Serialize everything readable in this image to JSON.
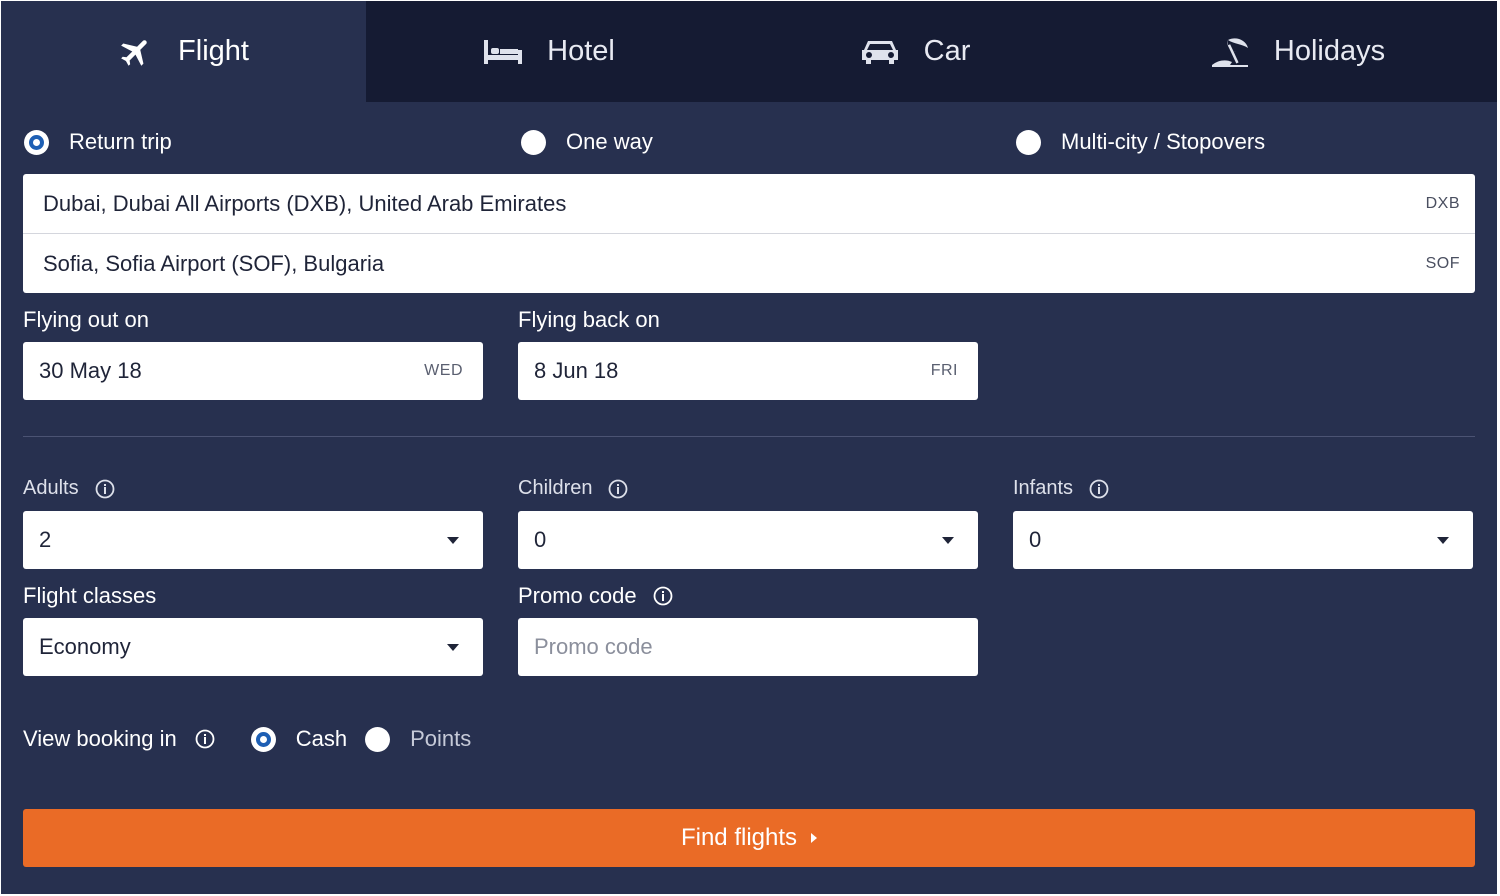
{
  "tabs": [
    {
      "label": "Flight",
      "icon": "plane-icon",
      "active": true
    },
    {
      "label": "Hotel",
      "icon": "bed-icon",
      "active": false
    },
    {
      "label": "Car",
      "icon": "car-icon",
      "active": false
    },
    {
      "label": "Holidays",
      "icon": "beach-umbrella-icon",
      "active": false
    }
  ],
  "trip_types": [
    {
      "label": "Return trip",
      "selected": true
    },
    {
      "label": "One way",
      "selected": false
    },
    {
      "label": "Multi-city / Stopovers",
      "selected": false
    }
  ],
  "route": {
    "origin": {
      "value": "Dubai, Dubai All Airports (DXB), United Arab Emirates",
      "code": "DXB"
    },
    "destination": {
      "value": "Sofia, Sofia Airport (SOF), Bulgaria",
      "code": "SOF"
    }
  },
  "dates": {
    "out": {
      "label": "Flying out on",
      "value": "30 May 18",
      "day": "WED"
    },
    "back": {
      "label": "Flying back on",
      "value": "8 Jun 18",
      "day": "FRI"
    }
  },
  "passengers": {
    "adults": {
      "label": "Adults",
      "value": "2"
    },
    "children": {
      "label": "Children",
      "value": "0"
    },
    "infants": {
      "label": "Infants",
      "value": "0"
    }
  },
  "flight_class": {
    "label": "Flight classes",
    "value": "Economy"
  },
  "promo": {
    "label": "Promo code",
    "placeholder": "Promo code"
  },
  "view_booking": {
    "label": "View booking in",
    "options": [
      {
        "label": "Cash",
        "selected": true
      },
      {
        "label": "Points",
        "selected": false
      }
    ]
  },
  "submit_label": "Find flights",
  "colors": {
    "panel": "#27304f",
    "tab_inactive": "#151b33",
    "accent_button": "#ea6b26",
    "radio_selected": "#1e5fb4"
  }
}
